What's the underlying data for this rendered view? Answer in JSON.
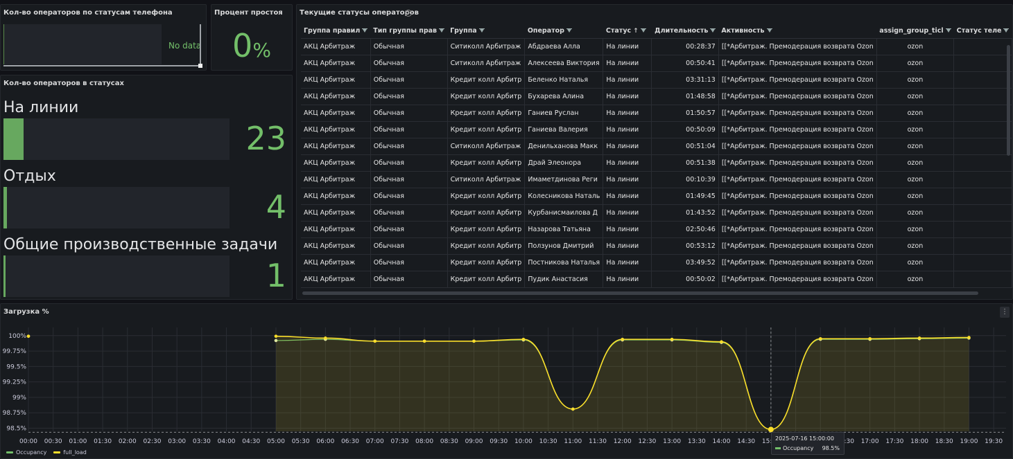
{
  "panel_phone": {
    "title": "Кол-во операторов по статусам телефона",
    "no_data": "No data"
  },
  "panel_idle": {
    "title": "Процент простоя",
    "value": "0",
    "unit": "%"
  },
  "panel_statuses": {
    "title": "Кол-во операторов в статусах",
    "items": [
      {
        "label": "На линии",
        "value": "23",
        "fill_fraction": 0.09
      },
      {
        "label": "Отдых",
        "value": "4",
        "fill_fraction": 0.015
      },
      {
        "label": "Общие производственные задачи",
        "value": "1",
        "fill_fraction": 0.004
      }
    ]
  },
  "panel_table": {
    "title": "Текущие статусы операторов",
    "columns": [
      "Группа правил",
      "Тип группы прав",
      "Группа",
      "Оператор",
      "Статус",
      "Длительность",
      "Активность",
      "assign_group_ticl",
      "Статус теле"
    ],
    "sort_column": "Статус",
    "sort_icon": "↑",
    "rows": [
      [
        "АКЦ Арбитраж",
        "Обычная",
        "Ситиколл Арбитраж",
        "Абдраева Алла",
        "На линии",
        "00:28:37",
        "[[*Арбитраж. Премодерация возврата Ozon",
        "ozon",
        ""
      ],
      [
        "АКЦ Арбитраж",
        "Обычная",
        "Ситиколл Арбитраж",
        "Алексеева Виктория",
        "На линии",
        "00:50:41",
        "[[*Арбитраж. Премодерация возврата Ozon",
        "ozon",
        ""
      ],
      [
        "АКЦ Арбитраж",
        "Обычная",
        "Кредит колл Арбитр",
        "Беленко Наталья",
        "На линии",
        "03:31:13",
        "[[*Арбитраж. Премодерация возврата Ozon",
        "ozon",
        ""
      ],
      [
        "АКЦ Арбитраж",
        "Обычная",
        "Кредит колл Арбитр",
        "Бухарева Алина",
        "На линии",
        "01:48:58",
        "[[*Арбитраж. Премодерация возврата Ozon",
        "ozon",
        ""
      ],
      [
        "АКЦ Арбитраж",
        "Обычная",
        "Кредит колл Арбитр",
        "Ганиев Руслан",
        "На линии",
        "01:50:57",
        "[[*Арбитраж. Премодерация возврата Ozon",
        "ozon",
        ""
      ],
      [
        "АКЦ Арбитраж",
        "Обычная",
        "Кредит колл Арбитр",
        "Ганиева Валерия",
        "На линии",
        "00:50:09",
        "[[*Арбитраж. Премодерация возврата Ozon",
        "ozon",
        ""
      ],
      [
        "АКЦ Арбитраж",
        "Обычная",
        "Ситиколл Арбитраж",
        "Денильханова Макк",
        "На линии",
        "00:51:04",
        "[[*Арбитраж. Премодерация возврата Ozon",
        "ozon",
        ""
      ],
      [
        "АКЦ Арбитраж",
        "Обычная",
        "Кредит колл Арбитр",
        "Драй Элеонора",
        "На линии",
        "00:51:38",
        "[[*Арбитраж. Премодерация возврата Ozon",
        "ozon",
        ""
      ],
      [
        "АКЦ Арбитраж",
        "Обычная",
        "Ситиколл Арбитраж",
        "Имаметдинова Реги",
        "На линии",
        "00:10:39",
        "[[*Арбитраж. Премодерация возврата Ozon",
        "ozon",
        ""
      ],
      [
        "АКЦ Арбитраж",
        "Обычная",
        "Кредит колл Арбитр",
        "Колесникова Наталь",
        "На линии",
        "01:49:45",
        "[[*Арбитраж. Премодерация возврата Ozon",
        "ozon",
        ""
      ],
      [
        "АКЦ Арбитраж",
        "Обычная",
        "Кредит колл Арбитр",
        "Курбанисмаилова Д",
        "На линии",
        "01:43:52",
        "[[*Арбитраж. Премодерация возврата Ozon",
        "ozon",
        ""
      ],
      [
        "АКЦ Арбитраж",
        "Обычная",
        "Кредит колл Арбитр",
        "Назарова Татьяна",
        "На линии",
        "02:50:46",
        "[[*Арбитраж. Премодерация возврата Ozon",
        "ozon",
        ""
      ],
      [
        "АКЦ Арбитраж",
        "Обычная",
        "Кредит колл Арбитр",
        "Ползунов Дмитрий",
        "На линии",
        "00:53:12",
        "[[*Арбитраж. Премодерация возврата Ozon",
        "ozon",
        ""
      ],
      [
        "АКЦ Арбитраж",
        "Обычная",
        "Кредит колл Арбитр",
        "Постникова Наталья",
        "На линии",
        "03:49:52",
        "[[*Арбитраж. Премодерация возврата Ozon",
        "ozon",
        ""
      ],
      [
        "АКЦ Арбитраж",
        "Обычная",
        "Кредит колл Арбитр",
        "Пудик Анастасия",
        "На линии",
        "00:50:02",
        "[[*Арбитраж. Премодерация возврата Ozon",
        "ozon",
        ""
      ]
    ]
  },
  "panel_chart": {
    "title": "Загрузка %",
    "menu_icon": "⋮"
  },
  "tooltip": {
    "time": "2025-07-16 15:00:00",
    "series": "Occupancy",
    "value": "98.5%"
  },
  "colors": {
    "green": "#73bf69",
    "yellow": "#fade2a",
    "bg": "#111217",
    "panel": "#181b1f"
  },
  "chart_data": {
    "type": "line",
    "title": "Загрузка %",
    "xlabel": "",
    "ylabel": "",
    "x_ticks": [
      "00:00",
      "00:30",
      "01:00",
      "01:30",
      "02:00",
      "02:30",
      "03:00",
      "03:30",
      "04:00",
      "04:30",
      "05:00",
      "05:30",
      "06:00",
      "06:30",
      "07:00",
      "07:30",
      "08:00",
      "08:30",
      "09:00",
      "09:30",
      "10:00",
      "10:30",
      "11:00",
      "11:30",
      "12:00",
      "12:30",
      "13:00",
      "13:30",
      "14:00",
      "14:30",
      "15:00",
      "15:30",
      "16:00",
      "16:30",
      "17:00",
      "17:30",
      "18:00",
      "18:30",
      "19:00",
      "19:30"
    ],
    "y_ticks": [
      "98.5%",
      "98.75%",
      "99%",
      "99.25%",
      "99.5%",
      "99.75%",
      "100%"
    ],
    "ylim": [
      98.45,
      100.02
    ],
    "xlim_hours": [
      0,
      19.75
    ],
    "grid": true,
    "legend_position": "bottom-left",
    "series": [
      {
        "name": "Occupancy",
        "color": "#73bf69",
        "x": [
          0,
          5,
          6,
          7,
          8,
          9,
          10,
          11,
          12,
          13,
          14,
          15,
          16,
          17,
          18,
          19
        ],
        "y": [
          99.99,
          99.92,
          99.94,
          99.91,
          99.91,
          99.91,
          99.93,
          98.81,
          99.93,
          99.93,
          99.89,
          98.48,
          99.94,
          99.94,
          99.95,
          99.96
        ]
      },
      {
        "name": "full_load",
        "color": "#fade2a",
        "x": [
          0,
          5,
          6,
          7,
          8,
          9,
          10,
          11,
          12,
          13,
          14,
          15,
          16,
          17,
          18,
          19
        ],
        "y": [
          99.99,
          99.99,
          99.96,
          99.91,
          99.91,
          99.91,
          99.94,
          98.81,
          99.94,
          99.94,
          99.9,
          98.48,
          99.95,
          99.95,
          99.96,
          99.97
        ]
      }
    ],
    "threshold": 98.48,
    "hover_x": 15
  }
}
